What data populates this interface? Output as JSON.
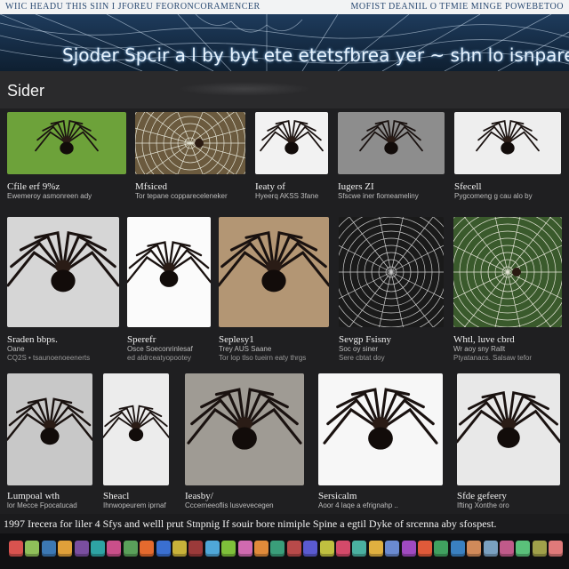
{
  "header": {
    "top_left": "WIIC HEADU THIS SIIN I JFOREU FEORONCORAMENCER",
    "top_right": "MOFIST DEANIIL O TFMIE MINGE POWEBETOO",
    "title": "Sjoder Spcir a l by byt ete etetsfbrea yer ~ shn lo isnpare"
  },
  "section": {
    "heading": "Sider"
  },
  "cards": [
    {
      "title": "Cfile erf 9%z",
      "sub": "Ewemeroy asmonreen ady",
      "sub2": "",
      "img": "green-spider"
    },
    {
      "title": "Mfsiced",
      "sub": "Tor tepane coppareceleneker",
      "sub2": "",
      "img": "web-brown"
    },
    {
      "title": "Ieaty of",
      "sub": "Hyeerq AKSS 3fane",
      "sub2": "",
      "img": "spider-white"
    },
    {
      "title": "Iugers ZI",
      "sub": "Sfscwe iner fiomeameliny",
      "sub2": "",
      "img": "spider-gray"
    },
    {
      "title": "Sfecell",
      "sub": "Pygcomeng g cau alo by",
      "sub2": "",
      "img": "spider-white2"
    },
    {
      "title": "Sraden bbps.",
      "sub": "Oane",
      "sub2": "CQ2S • tsaunoenoeenerts",
      "img": "spider-gray2"
    },
    {
      "title": "Sperefr",
      "sub": "Osce Soeconrinlesaf",
      "sub2": "ed aldrceatyopootey",
      "img": "spider-white3"
    },
    {
      "title": "Seplesy1",
      "sub": "Trey AUS Saane",
      "sub2": "Tor lop tlso tueirn eaty thrgs",
      "img": "spider-beige"
    },
    {
      "title": "Sevgp Fsisny",
      "sub": "Soc oy siner",
      "sub2": "Sere cbtat doy",
      "img": "web-dark"
    },
    {
      "title": "Whtl, luve cbrd",
      "sub": "Wr aoy sny Rallt",
      "sub2": "Ptyatanacs. Salsaw tefor",
      "img": "web-green"
    },
    {
      "title": "Lumpoal wth",
      "sub": "lor Mecce Fpocatucad",
      "sub2": "",
      "img": "spider-gray3"
    },
    {
      "title": "Sheacl",
      "sub": "Ihnwopeurem iprnaf",
      "sub2": "",
      "img": "spider-white4"
    },
    {
      "title": "Ieasby/",
      "sub": "Cccerneeoflis lusvevecegen",
      "sub2": "",
      "img": "spider-fabric"
    },
    {
      "title": "Sersicalm",
      "sub": "Aoor 4 laqe a efrignahp ..",
      "sub2": "",
      "img": "spider-white5"
    },
    {
      "title": "Sfde gefeery",
      "sub": "Ifting Xonthe oro",
      "sub2": "",
      "img": "spider-white6"
    }
  ],
  "caption": "1997 Irecera for liler 4 Sfys and welll prut Stnpnig If souir bore nimiple Spine a egtil Dyke of srcenna aby sfospest.",
  "dock_colors": [
    "#d9534f",
    "#8fbf5a",
    "#3c78b4",
    "#e0a03a",
    "#7a4ea0",
    "#2ea3a3",
    "#c94f8a",
    "#5aa05a",
    "#e46a2e",
    "#3a6fd0",
    "#c8b23a",
    "#9b3a3a",
    "#4fa7d8",
    "#7ebf3a",
    "#d06ab0",
    "#e08a3a",
    "#3a9e7a",
    "#b84a4a",
    "#5a5ad0",
    "#c0c040",
    "#d44a6a",
    "#4ab0a0",
    "#e0b040",
    "#6a8ad0",
    "#a04ac0",
    "#e05a3a",
    "#40a060",
    "#3a80c0",
    "#d08a5a",
    "#7aa0c0",
    "#c05a8a",
    "#5ac07a",
    "#a0a04a",
    "#e07a7a"
  ]
}
